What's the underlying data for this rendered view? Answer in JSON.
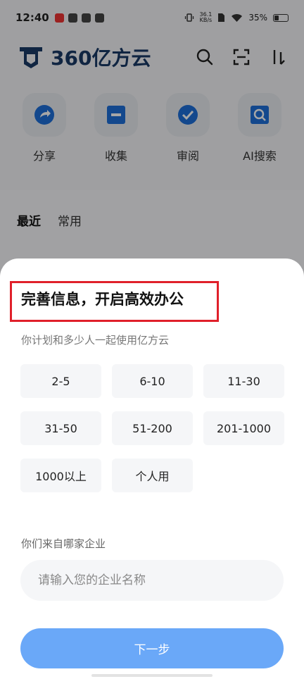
{
  "status_bar": {
    "time": "12:40",
    "network_speed_top": "36.1",
    "network_speed_unit": "KB/s",
    "battery": "35%"
  },
  "app": {
    "brand": "360亿方云",
    "quick_actions": [
      {
        "label": "分享",
        "icon": "share-icon"
      },
      {
        "label": "收集",
        "icon": "collect-icon"
      },
      {
        "label": "审阅",
        "icon": "review-icon"
      },
      {
        "label": "AI搜索",
        "icon": "ai-search-icon"
      }
    ],
    "tabs": {
      "recent": "最近",
      "common": "常用"
    }
  },
  "sheet": {
    "title": "完善信息，开启高效办公",
    "subtitle": "你计划和多少人一起使用亿方云",
    "team_sizes": [
      "2-5",
      "6-10",
      "11-30",
      "31-50",
      "51-200",
      "201-1000",
      "1000以上",
      "个人用"
    ],
    "company_label": "你们来自哪家企业",
    "company_placeholder": "请输入您的企业名称",
    "company_value": "",
    "next_label": "下一步"
  },
  "colors": {
    "brand": "#1a3a66",
    "accent": "#6aa8f8",
    "highlight_box": "#e0202a"
  }
}
